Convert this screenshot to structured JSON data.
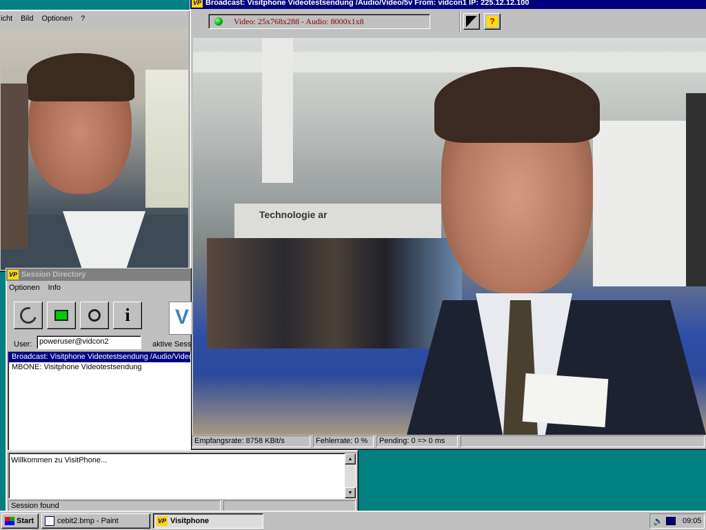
{
  "back_window": {
    "menu": [
      "icht",
      "Bild",
      "Optionen",
      "?"
    ]
  },
  "video_window": {
    "title": "Broadcast: Visitphone Videotestsendung /Audio/Video/5v From: vidcon1 IP: 225.12.12.100",
    "format_text": "Video: 25x768x288 - Audio: 8000x1x8",
    "status": {
      "rate": "Empfangsrate: 8758 KBit/s",
      "error": "Fehlerrate: 0 %",
      "pending": "Pending: 0 => 0 ms"
    },
    "booth_sign": "Technologie ar"
  },
  "session_directory": {
    "title": "Session Directory",
    "menu": [
      "Optionen",
      "Info"
    ],
    "user_label": "User:",
    "user_value": "poweruser@vidcon2",
    "active_sessions": "aktive Sess",
    "sessions": [
      "Broadcast: Visitphone Videotestsendung /Audio/Video",
      "MBONE: Visitphone Videotestsendung"
    ]
  },
  "message_window": {
    "text": "Willkommen zu VisitPhone...",
    "status": "Session found"
  },
  "taskbar": {
    "start": "Start",
    "tasks": [
      "cebit2.bmp - Paint",
      "Visitphone"
    ],
    "clock": "09:05"
  },
  "colors": {
    "titlebar": "#000080",
    "desktop": "#008080",
    "face": "#c0c0c0"
  }
}
